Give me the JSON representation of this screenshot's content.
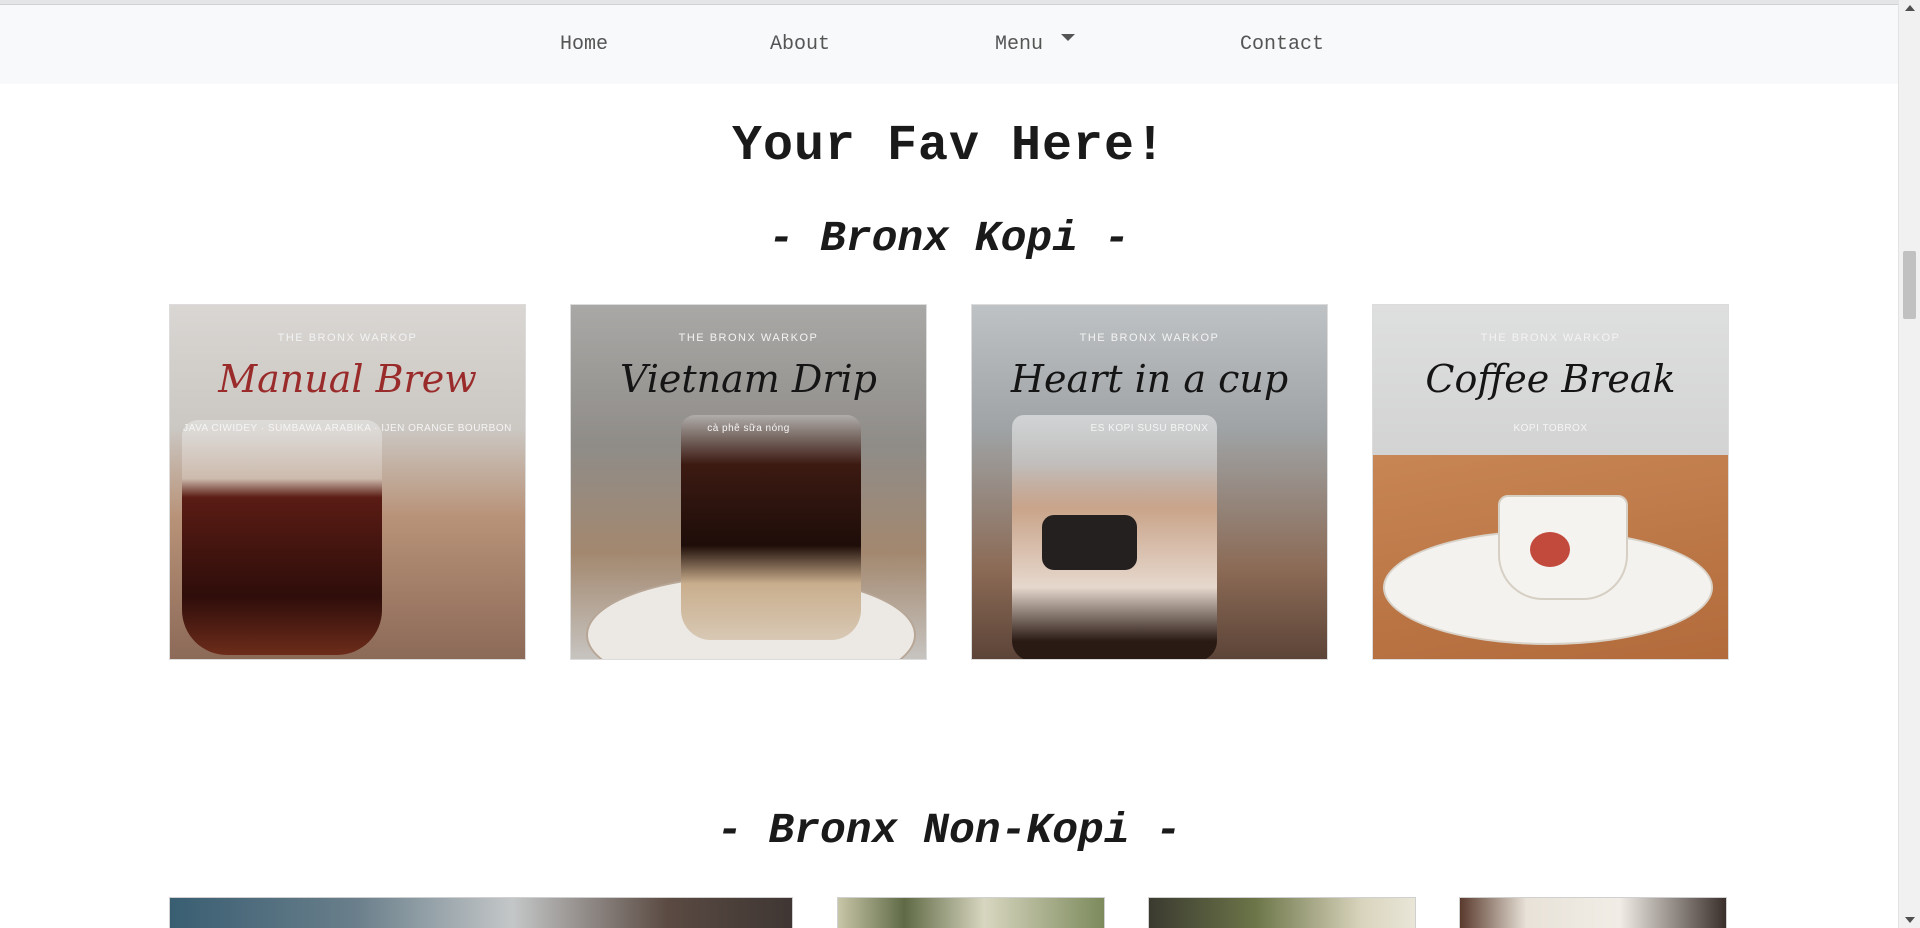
{
  "nav": {
    "items": [
      {
        "label": "Home"
      },
      {
        "label": "About"
      },
      {
        "label": "Menu"
      },
      {
        "label": "Contact"
      }
    ]
  },
  "page": {
    "title": "Your Fav Here!"
  },
  "sections": [
    {
      "title": "- Bronx Kopi -",
      "cards": [
        {
          "brand": "THE BRONX WARKOP",
          "name": "Manual Brew",
          "sub": "JAVA CIWIDEY · SUMBAWA ARABIKA · IJEN ORANGE BOURBON"
        },
        {
          "brand": "THE BRONX WARKOP",
          "name": "Vietnam Drip",
          "sub": "cà phê sữa nóng"
        },
        {
          "brand": "THE BRONX WARKOP",
          "name": "Heart in a cup",
          "sub": "ES KOPI SUSU BRONX"
        },
        {
          "brand": "THE BRONX WARKOP",
          "name": "Coffee Break",
          "sub": "KOPI TOBROX"
        }
      ]
    },
    {
      "title": "- Bronx Non-Kopi -"
    }
  ],
  "icons": {
    "menu_dropdown": "caret-down-icon",
    "scroll_up": "arrow-up-icon",
    "scroll_down": "arrow-down-icon"
  }
}
